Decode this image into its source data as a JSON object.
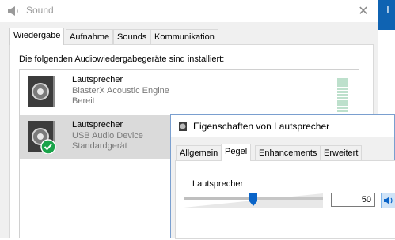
{
  "sound_window": {
    "title": "Sound",
    "close_glyph": "✕",
    "edge_letter": "T",
    "tabs": [
      {
        "label": "Wiedergabe",
        "active": true
      },
      {
        "label": "Aufnahme",
        "active": false
      },
      {
        "label": "Sounds",
        "active": false
      },
      {
        "label": "Kommunikation",
        "active": false
      }
    ],
    "heading": "Die folgenden Audiowiedergabegeräte sind installiert:",
    "devices": [
      {
        "name": "Lautsprecher",
        "description": "BlasterX Acoustic Engine",
        "status": "Bereit",
        "selected": false,
        "default": false,
        "icon": "speaker-icon"
      },
      {
        "name": "Lautsprecher",
        "description": "USB Audio Device",
        "status": "Standardgerät",
        "selected": true,
        "default": true,
        "icon": "speaker-default-icon"
      }
    ]
  },
  "properties_dialog": {
    "title": "Eigenschaften von Lautsprecher",
    "tabs": [
      {
        "label": "Allgemein",
        "active": false
      },
      {
        "label": "Pegel",
        "active": true
      },
      {
        "label": "Enhancements",
        "active": false
      },
      {
        "label": "Erweitert",
        "active": false
      }
    ],
    "level": {
      "label": "Lautsprecher",
      "value": "50",
      "fraction": 0.5
    },
    "mute_icon": "speaker-volume-icon"
  },
  "colors": {
    "accent": "#0f63b2",
    "selection": "#dadada",
    "default_check": "#1aa34a",
    "slider_thumb": "#0a64c8"
  }
}
